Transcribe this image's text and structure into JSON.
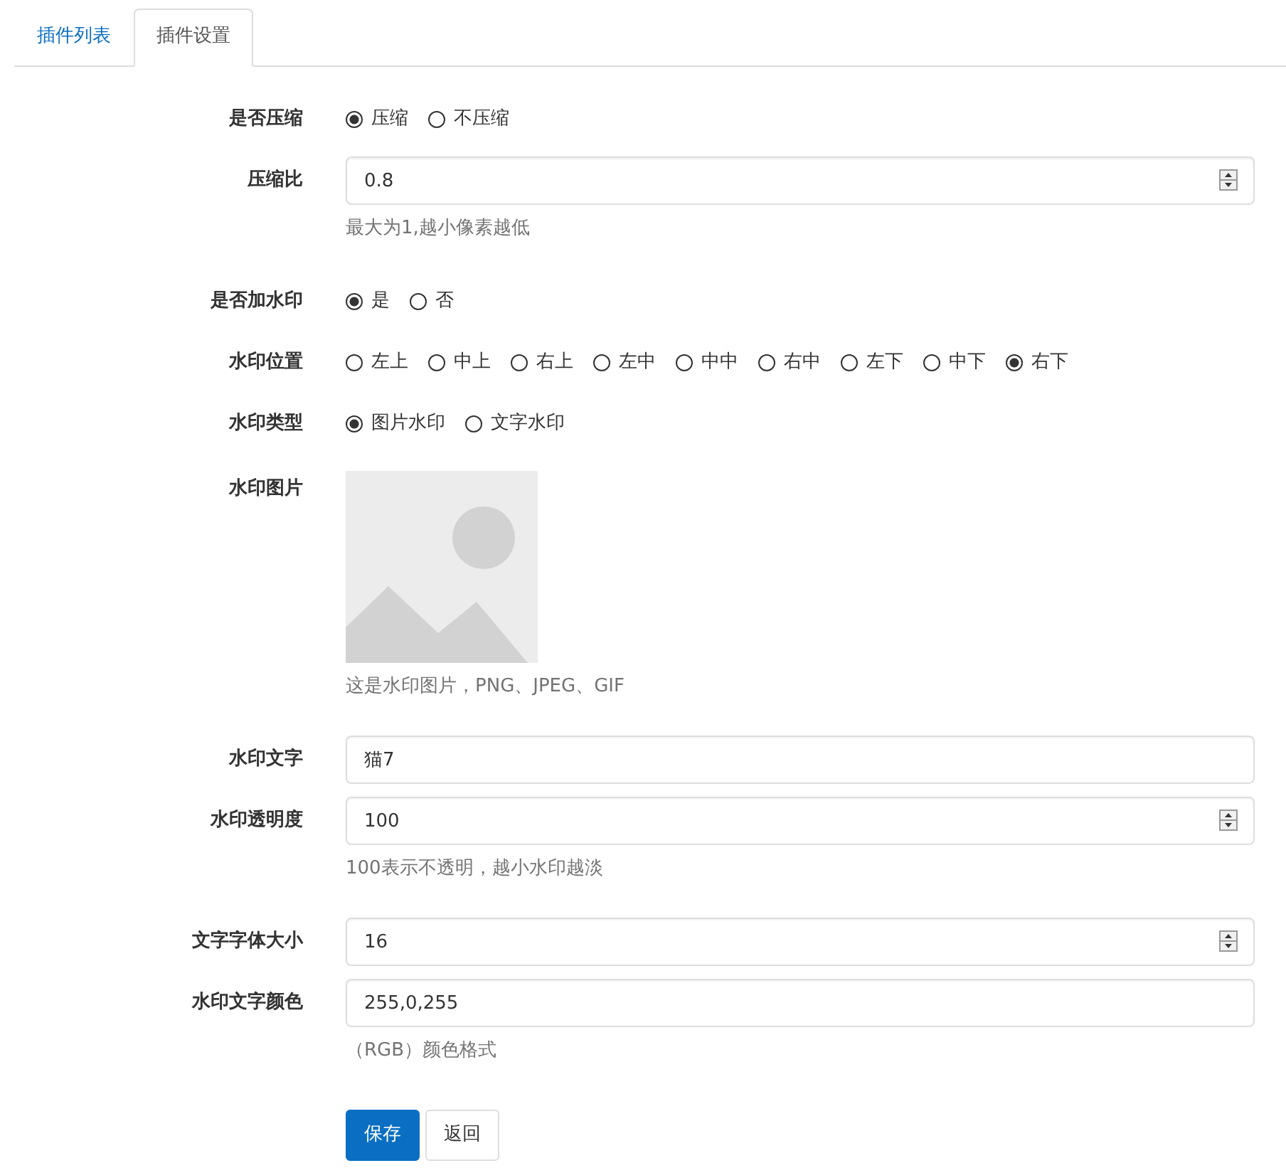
{
  "tabs": [
    {
      "label": "插件列表",
      "selected": false
    },
    {
      "label": "插件设置",
      "selected": true
    }
  ],
  "fields": [
    {
      "kind": "radio",
      "label": "是否压缩",
      "options": [
        {
          "label": "压缩",
          "selected": true
        },
        {
          "label": "不压缩",
          "selected": false
        }
      ]
    },
    {
      "kind": "number",
      "label": "压缩比",
      "value": "0.8",
      "help": "最大为1,越小像素越低"
    },
    {
      "kind": "radio",
      "label": "是否加水印",
      "options": [
        {
          "label": "是",
          "selected": true
        },
        {
          "label": "否",
          "selected": false
        }
      ]
    },
    {
      "kind": "radio",
      "label": "水印位置",
      "options": [
        {
          "label": "左上",
          "selected": false
        },
        {
          "label": "中上",
          "selected": false
        },
        {
          "label": "右上",
          "selected": false
        },
        {
          "label": "左中",
          "selected": false
        },
        {
          "label": "中中",
          "selected": false
        },
        {
          "label": "右中",
          "selected": false
        },
        {
          "label": "左下",
          "selected": false
        },
        {
          "label": "中下",
          "selected": false
        },
        {
          "label": "右下",
          "selected": true
        }
      ]
    },
    {
      "kind": "radio",
      "label": "水印类型",
      "options": [
        {
          "label": "图片水印",
          "selected": true
        },
        {
          "label": "文字水印",
          "selected": false
        }
      ]
    },
    {
      "kind": "image",
      "label": "水印图片",
      "help": "这是水印图片，PNG、JPEG、GIF"
    },
    {
      "kind": "text",
      "label": "水印文字",
      "value": "猫7"
    },
    {
      "kind": "number",
      "label": "水印透明度",
      "value": "100",
      "help": "100表示不透明，越小水印越淡"
    },
    {
      "kind": "number",
      "label": "文字字体大小",
      "value": "16"
    },
    {
      "kind": "text",
      "label": "水印文字颜色",
      "value": "255,0,255",
      "help": "（RGB）颜色格式"
    }
  ],
  "buttons": [
    {
      "label": "保存",
      "kind": "primary"
    },
    {
      "label": "返回",
      "kind": "default"
    }
  ]
}
